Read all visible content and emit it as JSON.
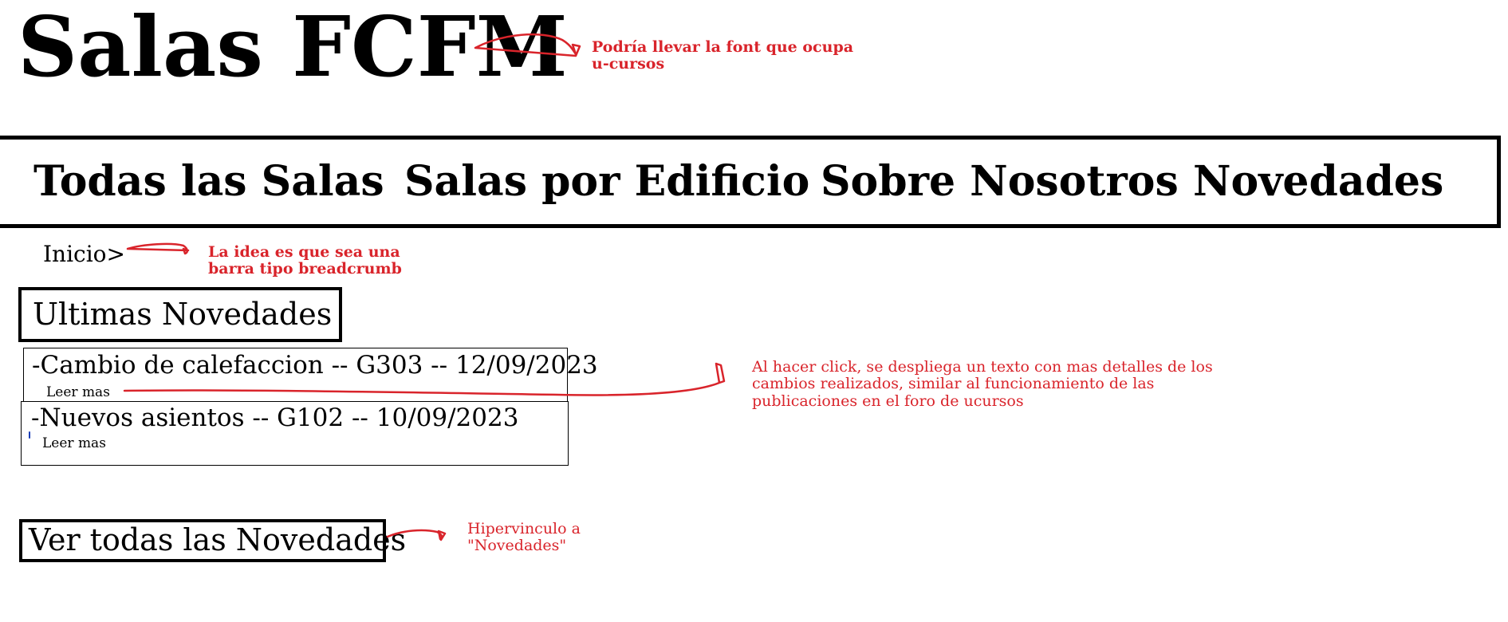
{
  "header": {
    "title": "Salas FCFM"
  },
  "nav": {
    "items": [
      {
        "label": "Todas las Salas"
      },
      {
        "label": "Salas por Edificio"
      },
      {
        "label": "Sobre Nosotros"
      },
      {
        "label": "Novedades"
      }
    ]
  },
  "breadcrumb": {
    "label": "Inicio>"
  },
  "news": {
    "section_title": "Ultimas Novedades",
    "items": [
      {
        "title": "-Cambio de calefaccion -- G303 -- 12/09/2023",
        "link": "Leer mas"
      },
      {
        "title": "-Nuevos asientos -- G102 -- 10/09/2023",
        "link": "Leer mas"
      }
    ],
    "see_all": "Ver todas las Novedades"
  },
  "annotations": {
    "font_note": [
      "Podría llevar la font que ocupa",
      "u-cursos"
    ],
    "breadcrumb_note": [
      "La idea es que sea una",
      "barra tipo breadcrumb"
    ],
    "leer_mas_note": [
      "Al hacer click, se despliega un texto con mas detalles de los",
      "cambios realizados, similar al funcionamiento de las",
      "publicaciones en el foro de ucursos"
    ],
    "link_note": [
      "Hipervinculo a",
      "\"Novedades\""
    ],
    "color": "#d9242b"
  }
}
